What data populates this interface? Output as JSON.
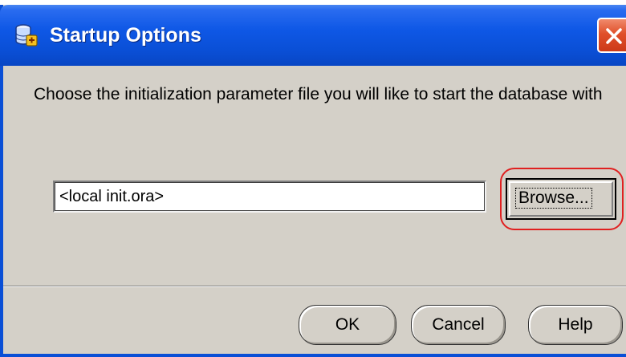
{
  "window": {
    "title": "Startup Options",
    "icon": "database-startup-icon",
    "close_icon": "close-icon"
  },
  "message": "Choose the initialization parameter file you will like to start the database with",
  "file_field": {
    "value": "<local init.ora>"
  },
  "browse_button": {
    "label": "Browse...",
    "highlight_color": "#e02020"
  },
  "buttons": {
    "ok": "OK",
    "cancel": "Cancel",
    "help": "Help"
  },
  "colors": {
    "titlebar": "#0a4fd6",
    "dialog_background": "#d4d0c8",
    "close_button": "#e0502a"
  }
}
